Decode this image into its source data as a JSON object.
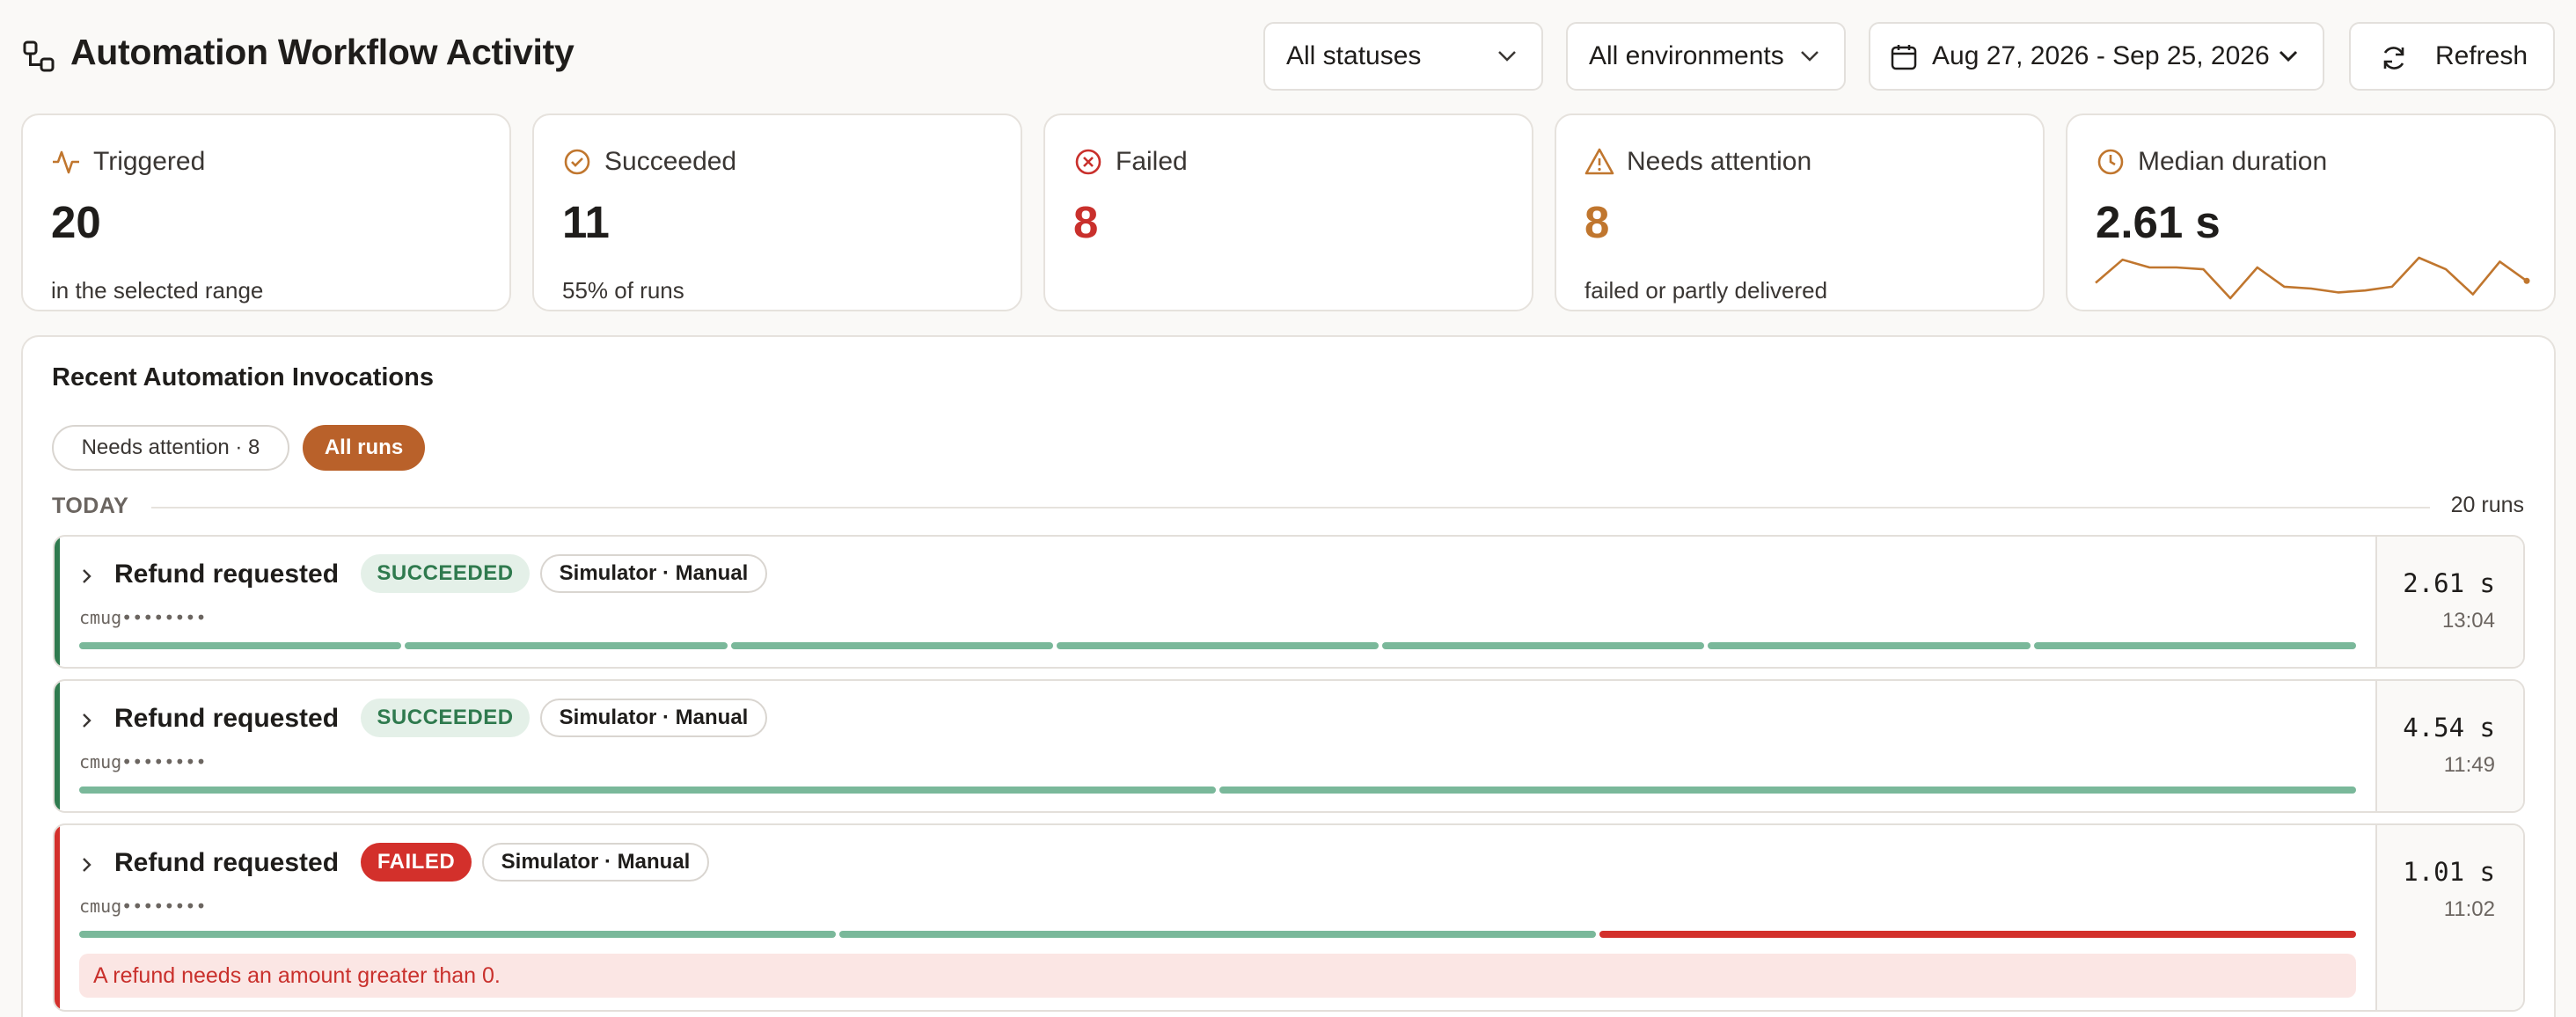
{
  "header": {
    "title": "Automation Workflow Activity",
    "status_filter": "All statuses",
    "environment_filter": "All environments",
    "date_range": "Aug 27, 2026 - Sep 25, 2026",
    "refresh_label": "Refresh"
  },
  "stats": [
    {
      "label": "Triggered",
      "value": "20",
      "sub": "in the selected range",
      "icon": "activity-icon"
    },
    {
      "label": "Succeeded",
      "value": "11",
      "sub": "55% of runs",
      "icon": "check-circle-icon"
    },
    {
      "label": "Failed",
      "value": "8",
      "sub": "",
      "icon": "x-circle-icon"
    },
    {
      "label": "Needs attention",
      "value": "8",
      "sub": "failed or partly delivered",
      "icon": "warning-icon"
    },
    {
      "label": "Median duration",
      "value": "2.61 s",
      "sub": "",
      "icon": "clock-icon"
    }
  ],
  "sparkline": {
    "values": [
      2.2,
      3.4,
      3.0,
      3.0,
      2.9,
      1.4,
      3.0,
      2.0,
      1.9,
      1.7,
      1.8,
      2.0,
      3.5,
      2.9,
      1.6,
      3.3,
      2.3
    ]
  },
  "panel": {
    "title": "Recent Automation Invocations",
    "filters": [
      "Needs attention · 8",
      "All runs"
    ],
    "group_label": "TODAY",
    "group_count": "20 runs"
  },
  "runs": [
    {
      "title": "Refund requested",
      "status": "SUCCEEDED",
      "tag": "Simulator · Manual",
      "id": "cmug••••••••",
      "duration": "2.61 s",
      "time": "13:04",
      "steps": [
        "ok",
        "ok",
        "ok",
        "ok",
        "ok",
        "ok",
        "ok"
      ]
    },
    {
      "title": "Refund requested",
      "status": "SUCCEEDED",
      "tag": "Simulator · Manual",
      "id": "cmug••••••••",
      "duration": "4.54 s",
      "time": "11:49",
      "steps": [
        "ok",
        "ok"
      ]
    },
    {
      "title": "Refund requested",
      "status": "FAILED",
      "tag": "Simulator · Manual",
      "id": "cmug••••••••",
      "duration": "1.01 s",
      "time": "11:02",
      "steps": [
        "ok",
        "ok",
        "bad"
      ],
      "error": "A refund needs an amount greater than 0."
    }
  ],
  "colors": {
    "accent": "#b9612a",
    "success": "#2f7a4e",
    "success_bar": "#7ab89a",
    "danger": "#d3302b",
    "warning": "#c0762e"
  }
}
